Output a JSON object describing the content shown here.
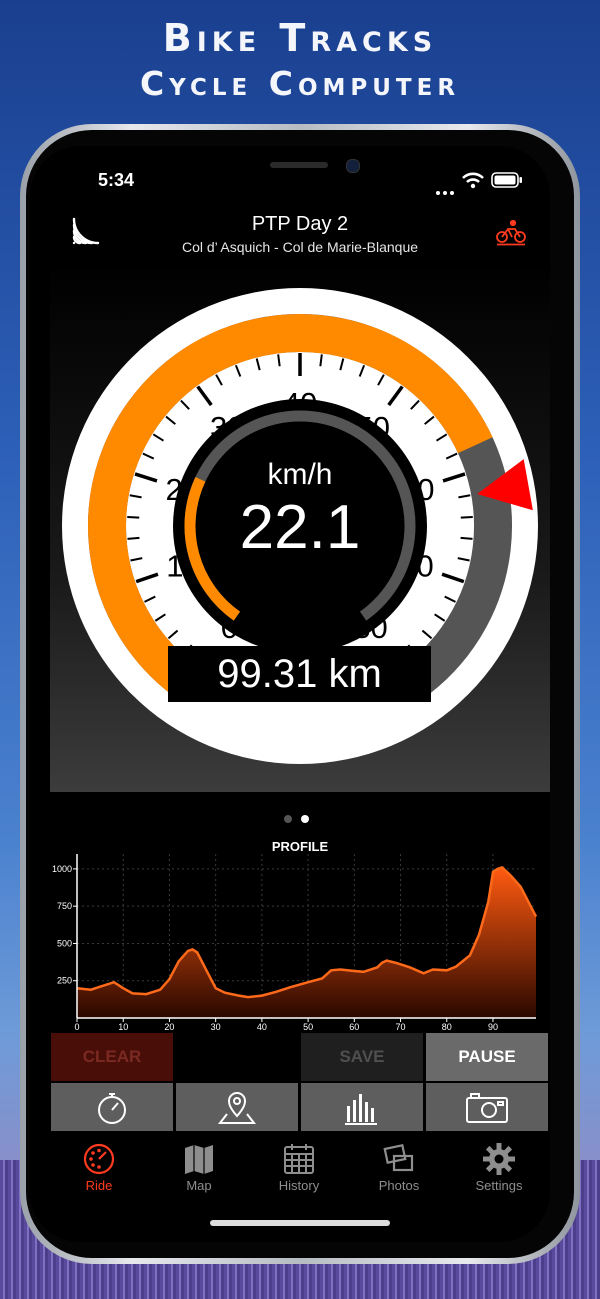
{
  "promo": {
    "title_line1": "Bike Tracks",
    "title_line2": "Cycle Computer"
  },
  "status_bar": {
    "time": "5:34"
  },
  "nav": {
    "title": "PTP Day 2",
    "subtitle": "Col d’ Asquich - Col de Marie-Blanque",
    "left_icon": "signal-waves-icon",
    "right_icon": "cyclist-icon"
  },
  "gauge": {
    "unit": "km/h",
    "speed": "22.1",
    "distance": "99.31 km",
    "scale_labels": [
      "0",
      "10",
      "20",
      "30",
      "40",
      "50",
      "60",
      "70",
      "80"
    ],
    "scale_min": 0,
    "scale_max": 80,
    "outer_fill_to": 58,
    "max_marker": 62,
    "inner_fill_to": 22.1,
    "colors": {
      "accent": "#ff8a00",
      "track": "#555555",
      "marker": "#ff0000"
    }
  },
  "pager": {
    "pages": 2,
    "active": 1
  },
  "profile": {
    "title": "PROFILE"
  },
  "chart_data": {
    "type": "area",
    "title": "PROFILE",
    "xlabel": "",
    "ylabel": "",
    "x_ticks": [
      "0",
      "10",
      "20",
      "30",
      "40",
      "50",
      "60",
      "70",
      "80",
      "90"
    ],
    "y_ticks": [
      "250",
      "500",
      "750",
      "1000"
    ],
    "xlim": [
      0,
      99.31
    ],
    "ylim": [
      0,
      1100
    ],
    "grid": true,
    "color": "#ff5a10",
    "x": [
      0,
      3,
      5,
      8,
      10,
      12,
      15,
      18,
      20,
      22,
      24,
      25,
      26,
      28,
      30,
      32,
      35,
      37,
      40,
      43,
      46,
      50,
      53,
      55,
      57,
      60,
      62,
      65,
      66,
      67,
      69,
      72,
      75,
      77,
      80,
      82,
      85,
      87,
      89,
      90,
      91,
      92,
      94,
      96,
      98,
      99.31
    ],
    "y": [
      200,
      190,
      210,
      240,
      200,
      165,
      160,
      190,
      260,
      380,
      450,
      460,
      440,
      320,
      200,
      170,
      150,
      140,
      150,
      175,
      205,
      240,
      265,
      320,
      325,
      315,
      310,
      340,
      370,
      385,
      370,
      340,
      300,
      325,
      320,
      345,
      420,
      560,
      780,
      980,
      1000,
      1010,
      950,
      880,
      760,
      680
    ]
  },
  "actions": {
    "clear": "CLEAR",
    "save": "SAVE",
    "pause": "PAUSE"
  },
  "tools": [
    "stopwatch-icon",
    "map-pin-icon",
    "bar-chart-icon",
    "camera-icon"
  ],
  "tabs": [
    {
      "label": "Ride",
      "icon": "speedometer-icon",
      "active": true
    },
    {
      "label": "Map",
      "icon": "map-icon",
      "active": false
    },
    {
      "label": "History",
      "icon": "calendar-icon",
      "active": false
    },
    {
      "label": "Photos",
      "icon": "photos-icon",
      "active": false
    },
    {
      "label": "Settings",
      "icon": "gear-icon",
      "active": false
    }
  ]
}
